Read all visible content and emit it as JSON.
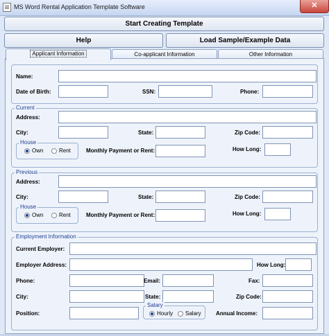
{
  "window": {
    "title": "MS Word Rental Application Template Software",
    "close_glyph": "✕"
  },
  "toolbar": {
    "start": "Start Creating Template",
    "help": "Help",
    "load_sample": "Load Sample/Example Data"
  },
  "tabs": [
    "Applicant Information",
    "Co-applicant Information",
    "Other Information"
  ],
  "applicant": {
    "name": "Name:",
    "dob": "Date of Birth:",
    "ssn": "SSN:",
    "phone": "Phone:"
  },
  "current": {
    "legend": "Current",
    "address": "Address:",
    "city": "City:",
    "state": "State:",
    "zip": "Zip Code:",
    "house_legend": "House",
    "own": "Own",
    "rent": "Rent",
    "payment": "Monthly Payment or Rent:",
    "how_long": "How Long:"
  },
  "previous": {
    "legend": "Previous",
    "address": "Address:",
    "city": "City:",
    "state": "State:",
    "zip": "Zip Code:",
    "house_legend": "House",
    "own": "Own",
    "rent": "Rent",
    "payment": "Monthly Payment or Rent:",
    "how_long": "How Long:"
  },
  "employment": {
    "legend": "Employment Information",
    "current_employer": "Current Employer:",
    "employer_address": "Employer Address:",
    "how_long": "How Long:",
    "phone": "Phone:",
    "email": "Email:",
    "fax": "Fax:",
    "city": "City:",
    "state": "State:",
    "zip": "Zip Code:",
    "position": "Position:",
    "salary_legend": "Salary",
    "hourly": "Hourly",
    "salary": "Salary",
    "annual_income": "Annual Income:"
  },
  "colors": {
    "background": "#dfe8f6",
    "legend_text": "#1f3d8f",
    "close": "#c9473c"
  }
}
